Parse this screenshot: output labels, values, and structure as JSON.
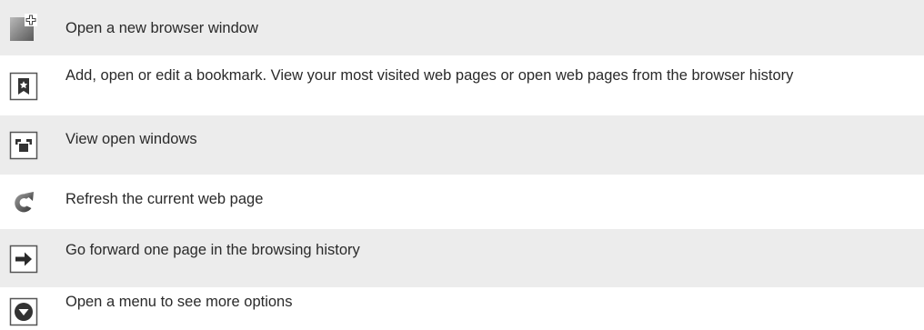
{
  "rows": [
    {
      "icon": "new-window-icon",
      "text": "Open a new browser window"
    },
    {
      "icon": "bookmark-icon",
      "text": "Add, open or edit a bookmark. View your most visited web pages or open web pages from the browser history"
    },
    {
      "icon": "open-windows-icon",
      "text": "View open windows"
    },
    {
      "icon": "refresh-icon",
      "text": "Refresh the current web page"
    },
    {
      "icon": "forward-arrow-icon",
      "text": "Go forward one page in the browsing history"
    },
    {
      "icon": "menu-icon",
      "text": "Open a menu to see more options"
    }
  ],
  "colors": {
    "row_shade": "#ececec",
    "text": "#2a2a2a",
    "icon_dark": "#333333",
    "icon_border": "#555555"
  }
}
